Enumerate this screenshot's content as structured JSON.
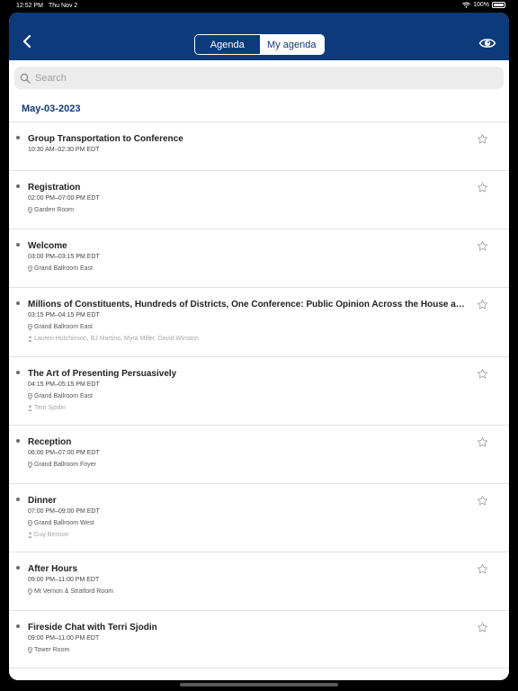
{
  "status_bar": {
    "time": "12:52 PM",
    "date": "Thu Nov 2",
    "battery": "100%",
    "battery_level": 1.0
  },
  "nav": {
    "segments": [
      {
        "label": "Agenda",
        "selected": true
      },
      {
        "label": "My agenda",
        "selected": false
      }
    ],
    "back_icon": "chevron-left-icon",
    "eye_icon": "eye-icon"
  },
  "search": {
    "placeholder": "Search",
    "value": ""
  },
  "date_header": "May-03-2023",
  "agenda_items": [
    {
      "title": "Group Transportation to Conference",
      "time": "10:30 AM–02:30 PM EDT",
      "location": "",
      "speakers": ""
    },
    {
      "title": "Registration",
      "time": "02:00 PM–07:00 PM EDT",
      "location": "Garden Room",
      "speakers": ""
    },
    {
      "title": "Welcome",
      "time": "03:00 PM–03:15 PM EDT",
      "location": "Grand Ballroom East",
      "speakers": ""
    },
    {
      "title": "Millions of Constituents, Hundreds of Districts, One Conference: Public Opinion Across the House and Senate",
      "time": "03:15 PM–04:15 PM EDT",
      "location": "Grand Ballroom East",
      "speakers": "Lauren Hutchinson, BJ Martino, Myra Miller, David Winston"
    },
    {
      "title": "The Art of Presenting Persuasively",
      "time": "04:15 PM–05:15 PM EDT",
      "location": "Grand Ballroom East",
      "speakers": "Terri Sjodin"
    },
    {
      "title": "Reception",
      "time": "06:00 PM–07:00 PM EDT",
      "location": "Grand Ballroom Foyer",
      "speakers": ""
    },
    {
      "title": "Dinner",
      "time": "07:00 PM–09:00 PM EDT",
      "location": "Grand Ballroom West",
      "speakers": "Guy Benson"
    },
    {
      "title": "After Hours",
      "time": "09:00 PM–11:00 PM EDT",
      "location": "Mt Vernon & Stratford Room",
      "speakers": ""
    },
    {
      "title": "Fireside Chat with Terri Sjodin",
      "time": "09:00 PM–11:00 PM EDT",
      "location": "Tower Room",
      "speakers": ""
    }
  ],
  "colors": {
    "brand": "#0d3a7a",
    "background": "#ffffff",
    "divider": "#e2e2e2"
  }
}
